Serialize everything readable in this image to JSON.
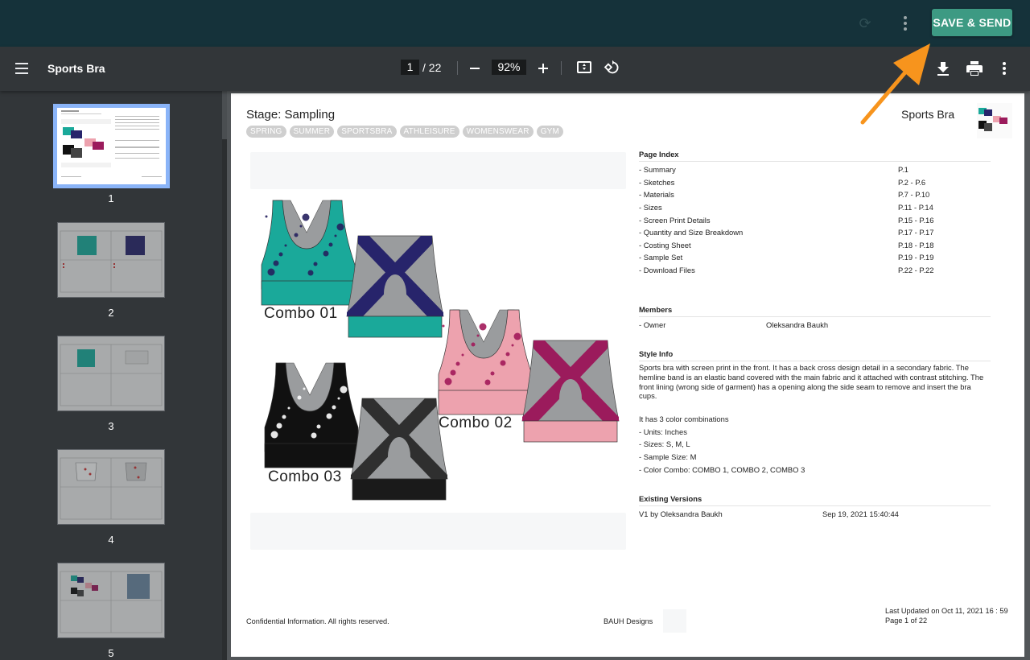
{
  "topbar": {
    "sync_icon": "sync-icon",
    "more_icon": "more-vert-icon",
    "save_send_label": "SAVE & SEND",
    "save_send_color": "#3d9a83",
    "background": "#15323a"
  },
  "toolbar": {
    "menu_icon": "hamburger-menu-icon",
    "title": "Sports Bra",
    "current_page": "1",
    "total_pages": "/ 22",
    "zoom_level": "92%",
    "zoom_out_icon": "minus-icon",
    "zoom_in_icon": "plus-icon",
    "fit_icon": "fit-to-page-icon",
    "rotate_icon": "rotate-icon",
    "download_icon": "download-icon",
    "print_icon": "print-icon",
    "more_icon": "more-vert-icon"
  },
  "thumbnails": [
    {
      "number": "1",
      "active": true
    },
    {
      "number": "2",
      "active": false
    },
    {
      "number": "3",
      "active": false
    },
    {
      "number": "4",
      "active": false
    },
    {
      "number": "5",
      "active": false
    }
  ],
  "document": {
    "stage": "Stage: Sampling",
    "tags": [
      "SPRING",
      "SUMMER",
      "SPORTSBRA",
      "ATHLEISURE",
      "WOMENSWEAR",
      "GYM"
    ],
    "style_name": "Sports Bra",
    "combos": [
      {
        "label": "Combo 01",
        "main": "#1aa99a",
        "accent": "#27246b",
        "print": "#25205e"
      },
      {
        "label": "Combo 02",
        "main": "#eda2ae",
        "accent": "#9b1b5c",
        "print": "#a21a5a"
      },
      {
        "label": "Combo 03",
        "main": "#111111",
        "accent": "#2f2f2f",
        "print": "#ffffff"
      }
    ],
    "strap_color": "#9a9c9e",
    "page_index": {
      "heading": "Page Index",
      "rows": [
        {
          "label": "- Summary",
          "pages": "P.1"
        },
        {
          "label": "- Sketches",
          "pages": "P.2 - P.6"
        },
        {
          "label": "- Materials",
          "pages": "P.7 - P.10"
        },
        {
          "label": "- Sizes",
          "pages": "P.11 - P.14"
        },
        {
          "label": "- Screen Print Details",
          "pages": "P.15 - P.16"
        },
        {
          "label": "- Quantity and Size Breakdown",
          "pages": "P.17 - P.17"
        },
        {
          "label": "- Costing Sheet",
          "pages": "P.18 - P.18"
        },
        {
          "label": "- Sample Set",
          "pages": "P.19 - P.19"
        },
        {
          "label": "- Download Files",
          "pages": "P.22 - P.22"
        }
      ]
    },
    "members": {
      "heading": "Members",
      "rows": [
        {
          "role": "- Owner",
          "name": "Oleksandra Baukh"
        }
      ]
    },
    "style_info": {
      "heading": "Style Info",
      "description": "Sports bra with screen print in the front. It has a back cross design detail in a secondary fabric. The hemline band is an elastic band covered with the main fabric and it attached with contrast stitching. The front lining (wrong side of garment) has a opening along the side seam to remove and insert the bra cups.",
      "lines": [
        "It has 3 color combinations",
        "- Units: Inches",
        "- Sizes: S, M, L",
        "- Sample Size: M",
        "- Color Combo: COMBO 1, COMBO 2, COMBO 3"
      ]
    },
    "versions": {
      "heading": "Existing Versions",
      "rows": [
        {
          "version": "V1 by Oleksandra Baukh",
          "date": "Sep 19, 2021 15:40:44"
        }
      ]
    },
    "footer": {
      "left": "Confidential Information. All rights reserved.",
      "company": "BAUH Designs",
      "updated": "Last Updated on Oct 11, 2021 16 : 59",
      "page_of": "Page 1 of 22"
    }
  },
  "annotation": {
    "arrow_color": "#f7941d",
    "points_to": "SAVE & SEND"
  }
}
